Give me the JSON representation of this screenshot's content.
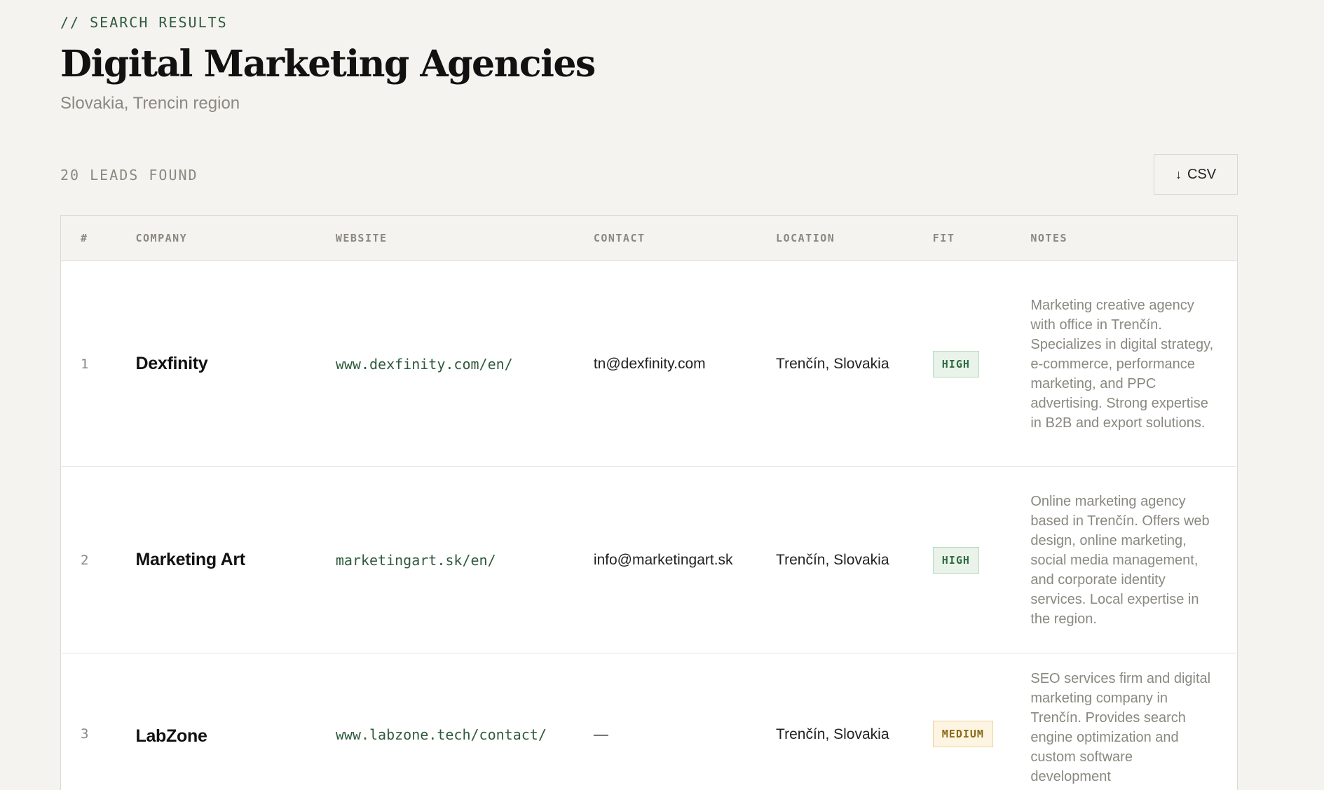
{
  "header": {
    "eyebrow": "// SEARCH RESULTS",
    "title": "Digital Marketing Agencies",
    "subtitle": "Slovakia, Trencin region"
  },
  "toolbar": {
    "count_label": "20 LEADS FOUND",
    "csv_label": "CSV",
    "csv_icon": "download-arrow-icon"
  },
  "table": {
    "columns": [
      "#",
      "COMPANY",
      "WEBSITE",
      "CONTACT",
      "LOCATION",
      "FIT",
      "NOTES"
    ],
    "rows": [
      {
        "num": "1",
        "company": "Dexfinity",
        "website": "www.dexfinity.com/en/",
        "contact": "tn@dexfinity.com",
        "location": "Trenčín, Slovakia",
        "fit": "HIGH",
        "notes": "Marketing creative agency with office in Trenčín. Specializes in digital strategy, e-commerce, performance marketing, and PPC advertising. Strong expertise in B2B and export solutions."
      },
      {
        "num": "2",
        "company": "Marketing Art",
        "website": "marketingart.sk/en/",
        "contact": "info@marketingart.sk",
        "location": "Trenčín, Slovakia",
        "fit": "HIGH",
        "notes": "Online marketing agency based in Trenčín. Offers web design, online marketing, social media management, and corporate identity services. Local expertise in the region."
      },
      {
        "num": "3",
        "company": "LabZone",
        "website": "www.labzone.tech/contact/",
        "contact": "—",
        "location": "Trenčín, Slovakia",
        "fit": "MEDIUM",
        "notes": "SEO services firm and digital marketing company in Trenčín. Provides search engine optimization and custom software development"
      }
    ]
  },
  "colors": {
    "accent_green": "#2f5a3d",
    "badge_high": "#2f6b40",
    "badge_medium": "#8a6a16",
    "background": "#f4f3ef"
  }
}
